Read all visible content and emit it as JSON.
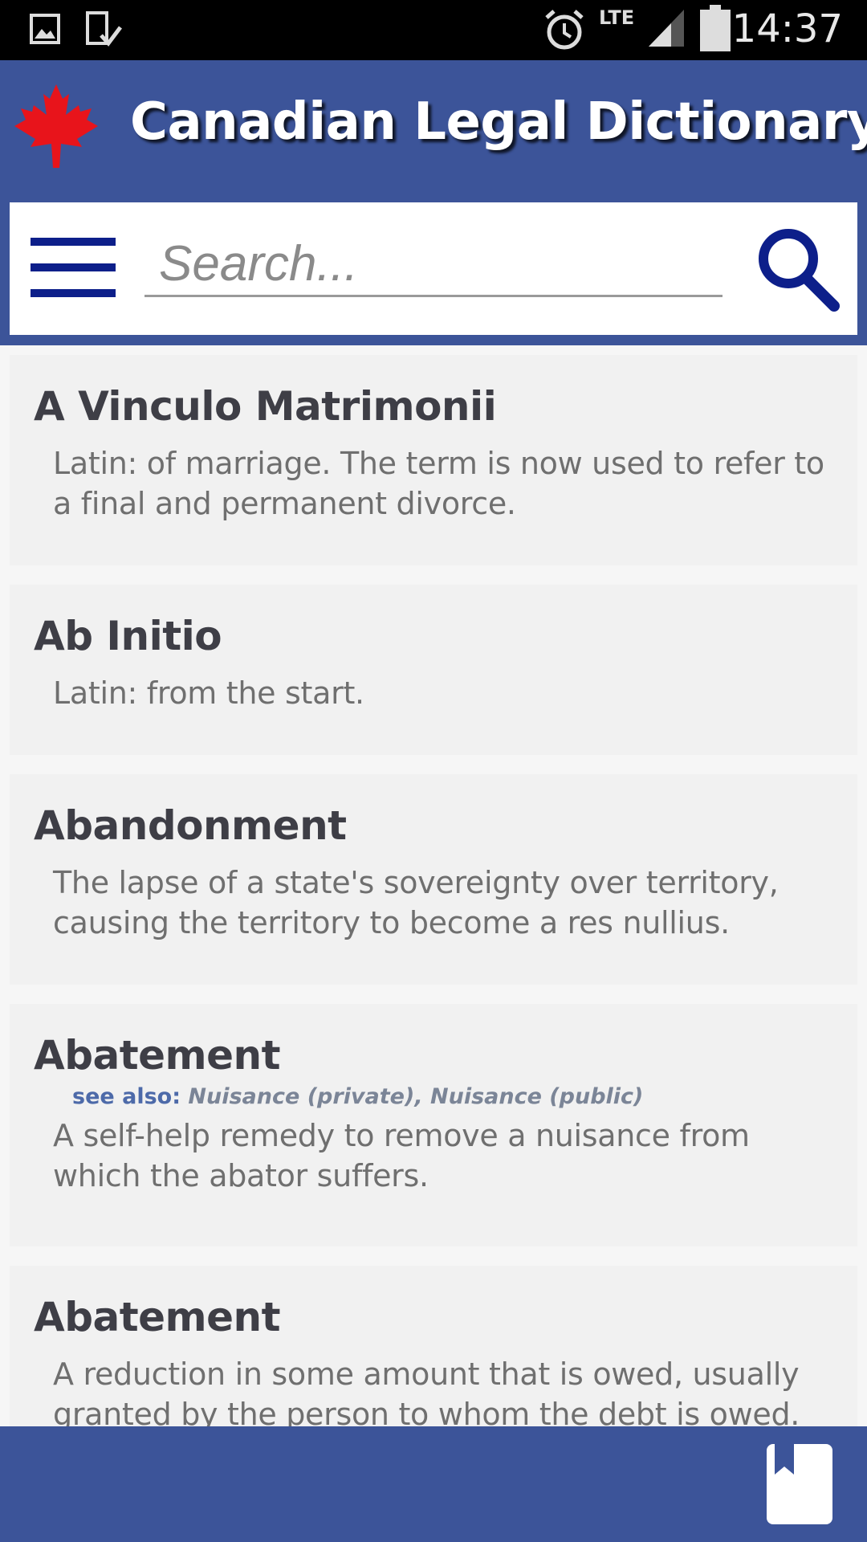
{
  "status_bar": {
    "time": "14:37",
    "network": "LTE",
    "icons": [
      "image-icon",
      "download-done-icon",
      "alarm-icon",
      "signal-icon",
      "battery-icon"
    ]
  },
  "app": {
    "title": "Canadian Legal Dictionary",
    "logo": "maple-leaf-icon",
    "colors": {
      "primary": "#3c5499",
      "menu": "#0d1f8a",
      "leaf": "#e8141b"
    }
  },
  "search": {
    "placeholder": "Search...",
    "value": ""
  },
  "entries": [
    {
      "term": "A Vinculo Matrimonii",
      "definition": "Latin: of marriage. The term is now used to refer to a final and permanent divorce."
    },
    {
      "term": "Ab Initio",
      "definition": "Latin: from the start."
    },
    {
      "term": "Abandonment",
      "definition": "The lapse of a state's sovereignty over territory, causing the territory to become a res nullius."
    },
    {
      "term": "Abatement",
      "see_also_label": "see also:",
      "see_also": [
        "Nuisance (private),",
        "Nuisance (public)"
      ],
      "definition": "A self-help remedy to remove a nuisance from which the abator suffers."
    },
    {
      "term": "Abatement",
      "definition": "A reduction in some amount that is owed, usually granted by the person to whom the debt is owed."
    }
  ],
  "bottom_bar": {
    "bookmark_icon": "bookmark-icon"
  }
}
